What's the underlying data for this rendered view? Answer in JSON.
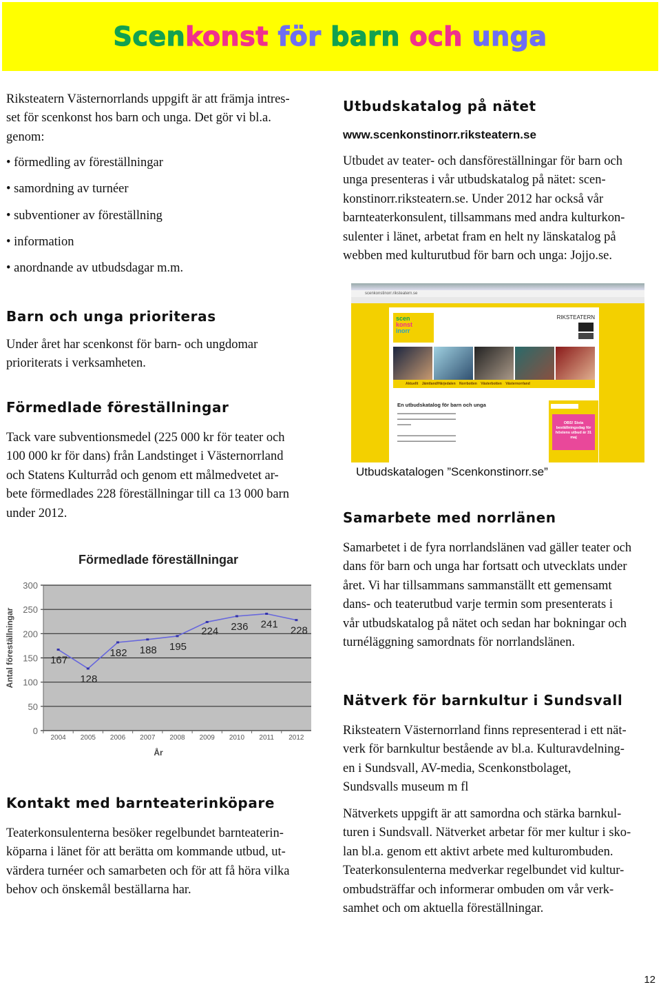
{
  "title": {
    "parts": [
      {
        "text": "Scen",
        "color": "#12a150"
      },
      {
        "text": "konst",
        "color": "#f0318c"
      },
      {
        "text": " för",
        "color": "#6e6ef2"
      },
      {
        "text": " barn",
        "color": "#12a150"
      },
      {
        "text": " och",
        "color": "#f0318c"
      },
      {
        "text": " unga",
        "color": "#6e6ef2"
      }
    ]
  },
  "left": {
    "intro": [
      "Riksteatern Västernorrlands uppgift är att främja intres-",
      "set för scenkonst hos barn och unga. Det gör vi bl.a.",
      "genom:"
    ],
    "bullets": [
      "• förmedling av föreställningar",
      "• samordning av turnéer",
      "• subventioner av föreställning",
      "• information",
      "• anordnande av utbudsdagar m.m."
    ],
    "s1_heading": "Barn och unga prioriteras",
    "s1_text": [
      "Under året har scenkonst för barn- och ungdomar",
      "prioriterats i verksamheten."
    ],
    "s2_heading": "Förmedlade föreställningar",
    "s2_text": [
      "Tack vare subventionsmedel (225 000 kr för teater och",
      "100 000 kr för dans) från Landstinget i Västernorrland",
      "och Statens Kulturråd och genom ett målmedvetet ar-",
      "bete förmedlades 228 föreställningar till ca 13 000 barn",
      "under 2012."
    ],
    "s3_heading": "Kontakt med barnteaterinköpare",
    "s3_text": [
      "Teaterkonsulenterna besöker regelbundet barnteaterin-",
      "köparna i länet för att berätta om kommande utbud, ut-",
      "värdera turnéer och samarbeten och för att få höra vilka",
      "behov och önskemål beställarna har."
    ]
  },
  "right": {
    "s1_heading": "Utbudskatalog på nätet",
    "url": "www.scenkonstinorr.riksteatern.se",
    "s1_text": [
      "Utbudet av teater- och dansföreställningar för barn och",
      "unga presenteras i vår utbudskatalog på nätet: scen-",
      "konstinorr.riksteatern.se. Under 2012 har också vår",
      "barnteaterkonsulent, tillsammans med andra kulturkon-",
      "sulenter i länet, arbetat fram en helt ny länskatalog på",
      "webben med kulturutbud för barn och unga: Jojjo.se."
    ],
    "screenshot": {
      "address": "scenkonstinorr.riksteatern.se",
      "logo": [
        "scen",
        "konst",
        "inorr"
      ],
      "brand": "RIKSTEATERN",
      "nav": "Aktuellt Jämtland/Härjedalen Norrbotten Västerbotten Västernorrland",
      "heading": "En utbudskatalog för barn och unga",
      "notice": "OBS! Sista beställningsdag för höstens utbud är 31 maj"
    },
    "caption": "Utbudskatalogen ”Scenkonstinorr.se”",
    "s2_heading": "Samarbete med norrlänen",
    "s2_text": [
      "Samarbetet i de fyra norrlandslänen vad gäller teater och",
      "dans för barn och unga har fortsatt och utvecklats under",
      "året. Vi har tillsammans sammanställt ett gemensamt",
      "dans- och teaterutbud varje termin som presenterats i",
      "vår utbudskatalog på nätet och sedan har bokningar och",
      "turnéläggning samordnats för norrlandslänen."
    ],
    "s3_heading": "Nätverk för barnkultur i Sundsvall",
    "s3_text_a": [
      "Riksteatern Västernorrland finns representerad i ett nät-",
      "verk för barnkultur bestående av bl.a. Kulturavdelning-",
      "en i Sundsvall, AV-media, Scenkonstbolaget,",
      "Sundsvalls museum m fl"
    ],
    "s3_text_b": [
      "Nätverkets uppgift är att samordna och stärka barnkul-",
      "turen i Sundsvall. Nätverket arbetar för mer kultur i sko-",
      "lan bl.a. genom ett aktivt arbete med kulturombuden.",
      "Teaterkonsulenterna medverkar regelbundet vid kultur-",
      "ombudsträffar och informerar ombuden om vår verk-",
      "samhet och om aktuella föreställningar."
    ]
  },
  "page_number": "12",
  "chart_data": {
    "type": "line",
    "title": "Förmedlade föreställningar",
    "xlabel": "År",
    "ylabel": "Antal föreställningar",
    "categories": [
      "2004",
      "2005",
      "2006",
      "2007",
      "2008",
      "2009",
      "2010",
      "2011",
      "2012"
    ],
    "values": [
      167,
      128,
      182,
      188,
      195,
      224,
      236,
      241,
      228
    ],
    "ylim": [
      0,
      300
    ],
    "yticks": [
      0,
      50,
      100,
      150,
      200,
      250,
      300
    ],
    "grid": true,
    "legend": "none",
    "line_color": "#6666dd",
    "plot_background": "#c0c0c0"
  }
}
